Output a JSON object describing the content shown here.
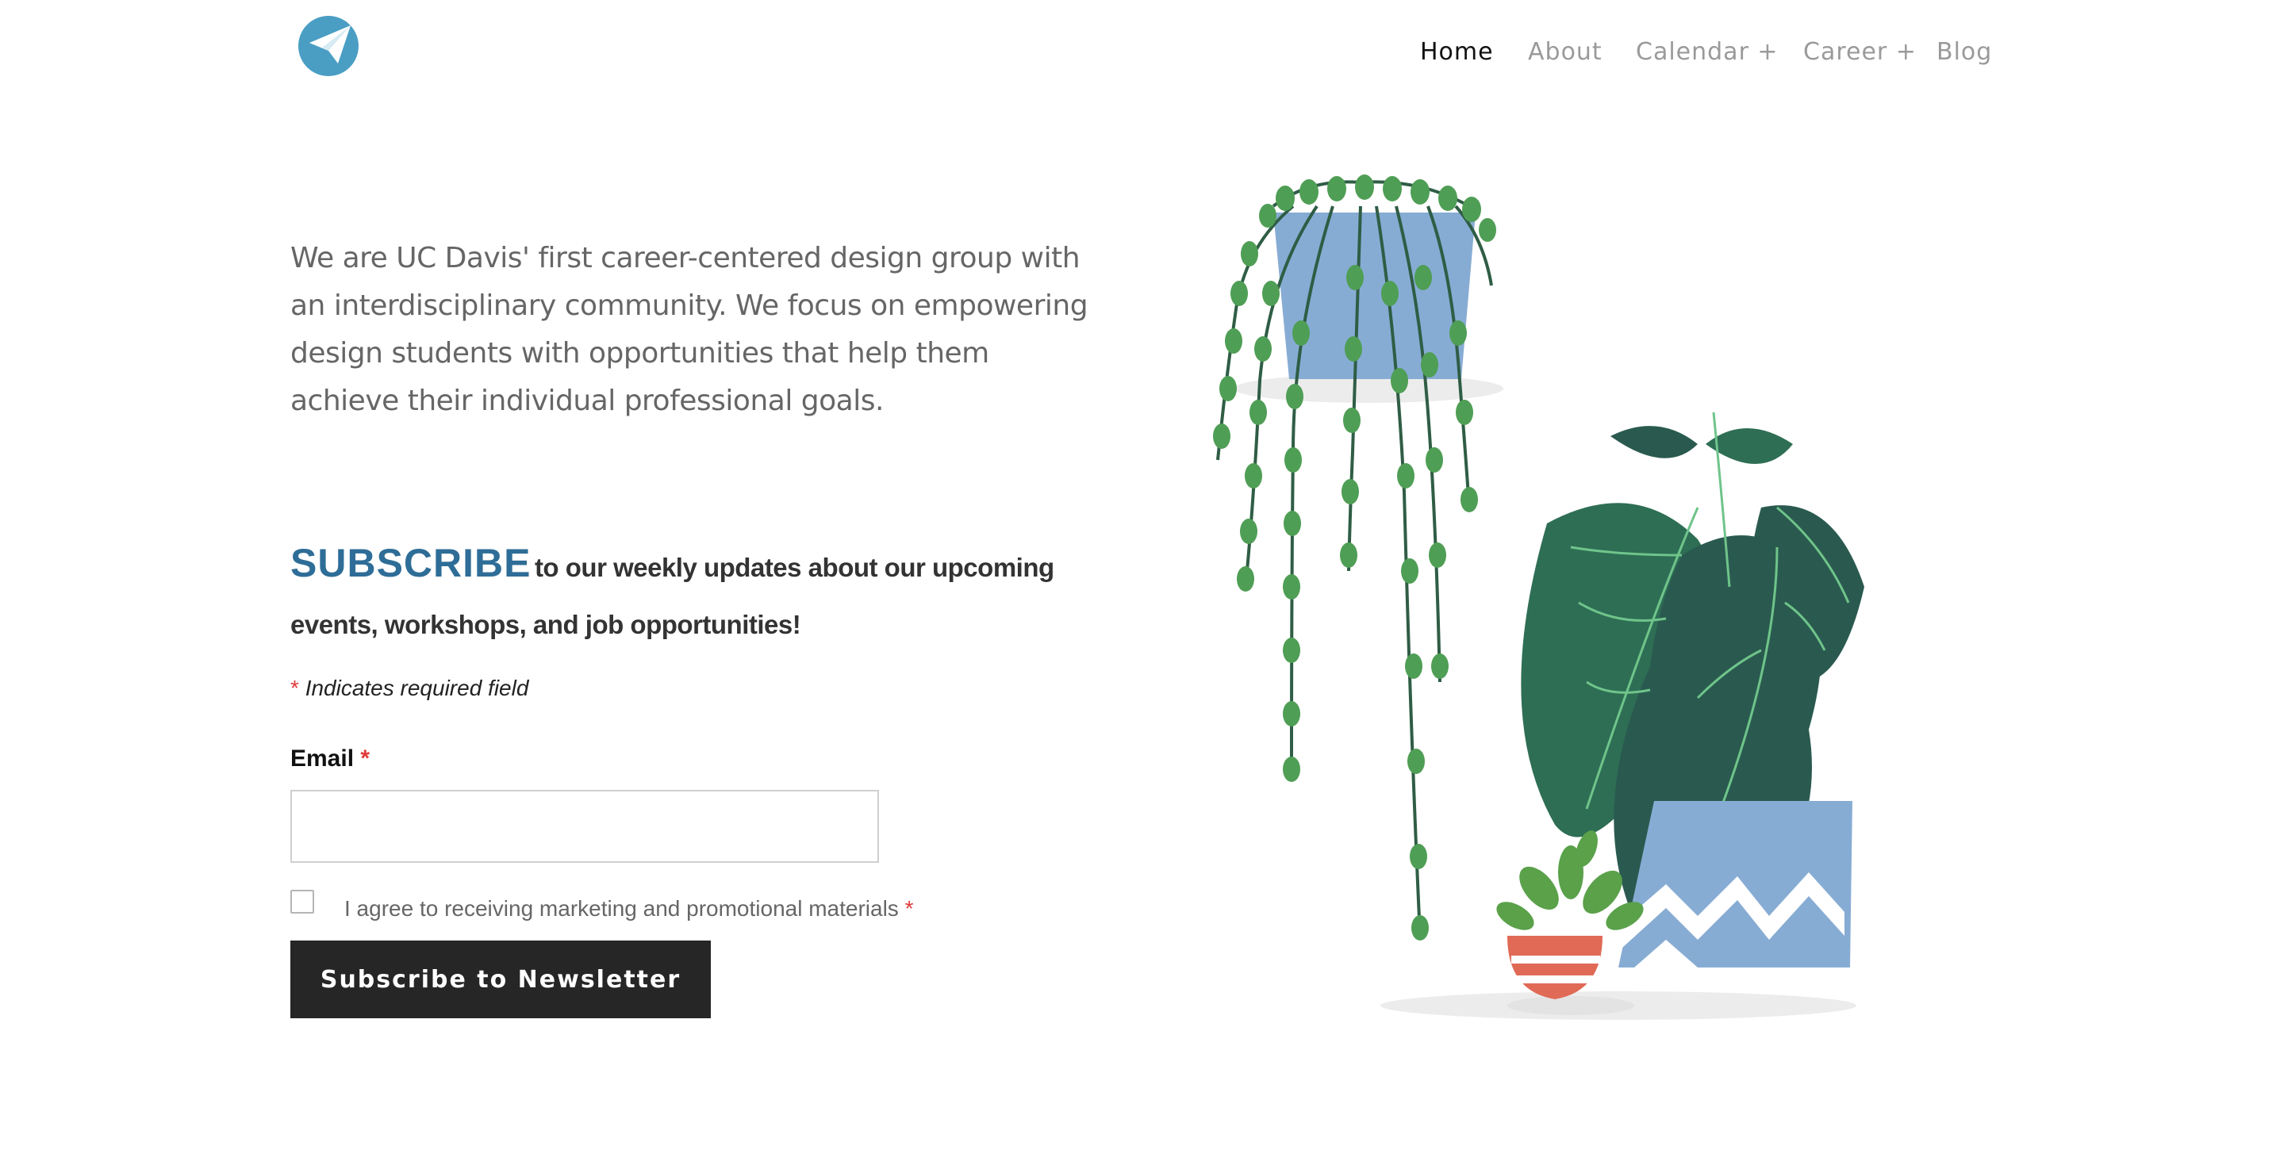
{
  "header": {
    "logo_icon": "paper-plane-icon",
    "nav": [
      {
        "label": "Home",
        "active": true
      },
      {
        "label": "About",
        "active": false
      },
      {
        "label": "Calendar +",
        "active": false
      },
      {
        "label": "Career +",
        "active": false
      },
      {
        "label": "Blog",
        "active": false
      }
    ]
  },
  "intro": {
    "text": "We are UC Davis' first career-centered design group with an interdisciplinary community. We focus on empowering design students with opportunities that help them achieve their individual professional goals."
  },
  "subscribe": {
    "title": "SUBSCRIBE",
    "text": "to our weekly updates about our upcoming events, workshops, and job opportunities!",
    "required_star": "*",
    "required_note": "Indicates required field",
    "email_label": "Email",
    "email_value": "",
    "agree_label": "I agree to receiving marketing and promotional materials",
    "button_label": "Subscribe to Newsletter"
  },
  "colors": {
    "accent": "#2e6d97",
    "logo": "#4a9ec4",
    "button": "#262626",
    "required": "#e03a3a",
    "pot_blue": "#87acd4",
    "leaf_dark": "#2a5a4f",
    "leaf_green": "#4f9e55",
    "pot_red": "#e06a56"
  },
  "illustration": {
    "icon": "potted-plants-illustration"
  }
}
